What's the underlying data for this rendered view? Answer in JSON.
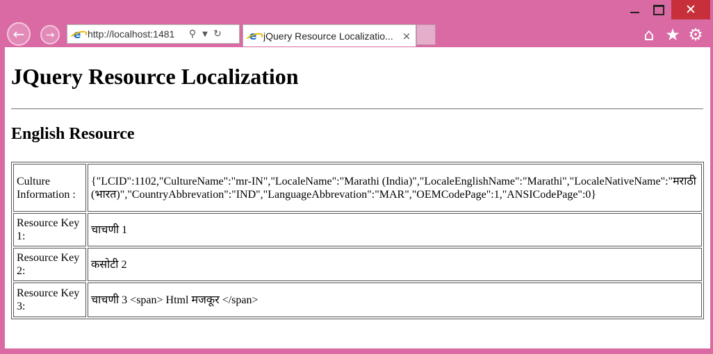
{
  "browser": {
    "url": "http://localhost:1481",
    "tab_title": "jQuery Resource Localizatio...",
    "tab_close_glyph": "×"
  },
  "page": {
    "title": "JQuery Resource Localization",
    "section_title": "English Resource",
    "rows": [
      {
        "label": "Culture Information :",
        "value": "{\"LCID\":1102,\"CultureName\":\"mr-IN\",\"LocaleName\":\"Marathi (India)\",\"LocaleEnglishName\":\"Marathi\",\"LocaleNativeName\":\"मराठी (भारत)\",\"CountryAbbrevation\":\"IND\",\"LanguageAbbrevation\":\"MAR\",\"OEMCodePage\":1,\"ANSICodePage\":0}"
      },
      {
        "label": "Resource Key 1:",
        "value": "चाचणी 1"
      },
      {
        "label": "Resource Key 2:",
        "value": "कसोटी 2"
      },
      {
        "label": "Resource Key 3:",
        "value": "चाचणी 3 <span> Html मजकूर </span>"
      }
    ]
  },
  "colors": {
    "chrome_background": "#d96aa4",
    "close_button": "#c7303a",
    "page_background": "#ffffff"
  },
  "icons": [
    "back-icon",
    "forward-icon",
    "ie-logo-icon",
    "search-icon",
    "dropdown-icon",
    "refresh-icon",
    "close-icon",
    "home-icon",
    "star-icon",
    "gear-icon",
    "minimize-icon",
    "maximize-icon"
  ]
}
